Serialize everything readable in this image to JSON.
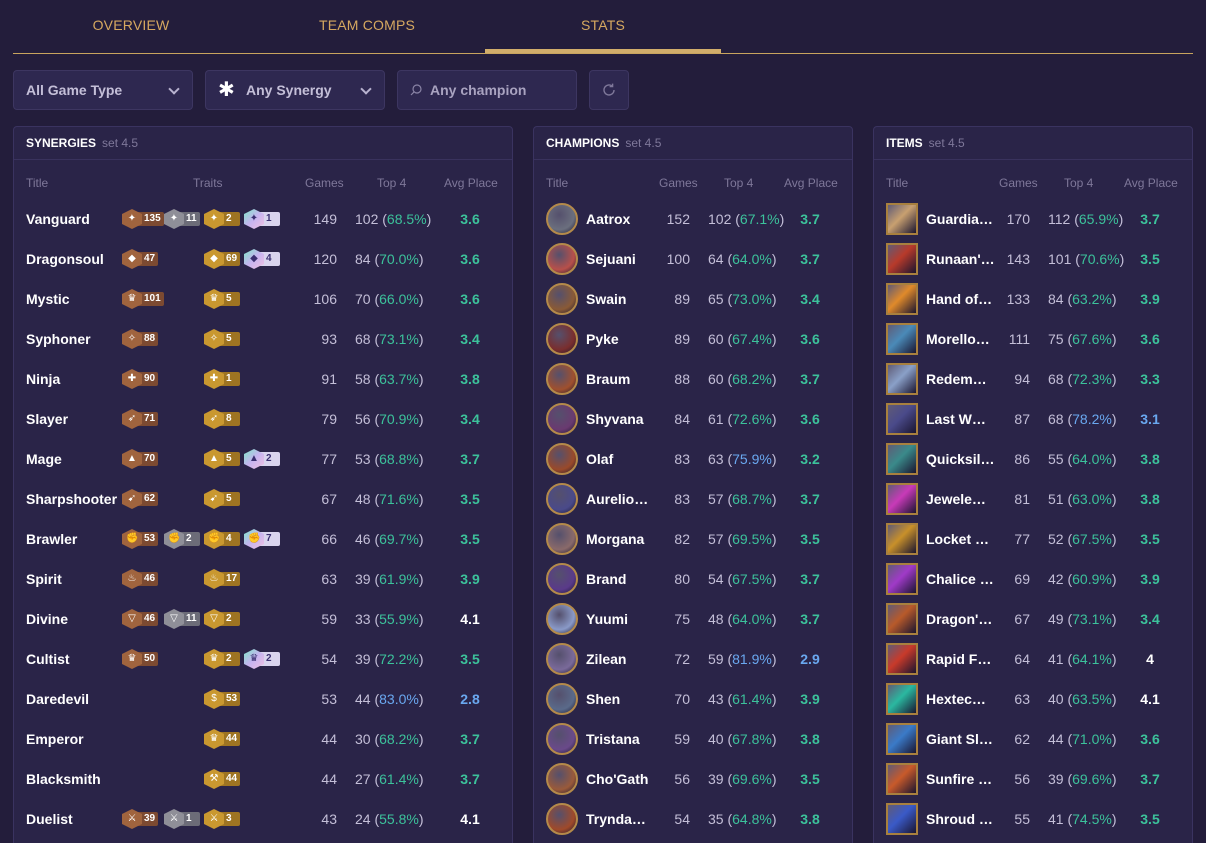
{
  "tabs": [
    {
      "label": "OVERVIEW",
      "active": false
    },
    {
      "label": "TEAM COMPS",
      "active": false
    },
    {
      "label": "STATS",
      "active": true
    }
  ],
  "filters": {
    "game_type": "All Game Type",
    "synergy": "Any Synergy",
    "champion_placeholder": "Any champion"
  },
  "colors": {
    "accent_gold": "#d1ad6b",
    "pct_green": "#3cc29b",
    "pct_blue": "#6aa8f0",
    "background": "#231d3b"
  },
  "synergies": {
    "title": "SYNERGIES",
    "set": "set 4.5",
    "headers": {
      "title": "Title",
      "traits": "Traits",
      "games": "Games",
      "top4": "Top 4",
      "avg": "Avg Place"
    },
    "rows": [
      {
        "name": "Vanguard",
        "traits": [
          {
            "tier": "bronze",
            "count": "135"
          },
          {
            "tier": "silver",
            "count": "11"
          },
          {
            "tier": "gold",
            "count": "2"
          },
          {
            "tier": "chroma",
            "count": "1"
          }
        ],
        "games": "149",
        "top4": "102",
        "pct": "68.5%",
        "avg": "3.6"
      },
      {
        "name": "Dragonsoul",
        "traits": [
          {
            "tier": "bronze",
            "count": "47"
          },
          {
            "tier": "gold",
            "count": "69"
          },
          {
            "tier": "chroma",
            "count": "4"
          }
        ],
        "games": "120",
        "top4": "84",
        "pct": "70.0%",
        "avg": "3.6"
      },
      {
        "name": "Mystic",
        "traits": [
          {
            "tier": "bronze",
            "count": "101"
          },
          {
            "tier": "gold",
            "count": "5"
          }
        ],
        "games": "106",
        "top4": "70",
        "pct": "66.0%",
        "avg": "3.6"
      },
      {
        "name": "Syphoner",
        "traits": [
          {
            "tier": "bronze",
            "count": "88"
          },
          {
            "tier": "gold",
            "count": "5"
          }
        ],
        "games": "93",
        "top4": "68",
        "pct": "73.1%",
        "avg": "3.4"
      },
      {
        "name": "Ninja",
        "traits": [
          {
            "tier": "bronze",
            "count": "90"
          },
          {
            "tier": "gold",
            "count": "1"
          }
        ],
        "games": "91",
        "top4": "58",
        "pct": "63.7%",
        "avg": "3.8"
      },
      {
        "name": "Slayer",
        "traits": [
          {
            "tier": "bronze",
            "count": "71"
          },
          {
            "tier": "gold",
            "count": "8"
          }
        ],
        "games": "79",
        "top4": "56",
        "pct": "70.9%",
        "avg": "3.4"
      },
      {
        "name": "Mage",
        "traits": [
          {
            "tier": "bronze",
            "count": "70"
          },
          {
            "tier": "gold",
            "count": "5"
          },
          {
            "tier": "chroma",
            "count": "2"
          }
        ],
        "games": "77",
        "top4": "53",
        "pct": "68.8%",
        "avg": "3.7"
      },
      {
        "name": "Sharpshooter",
        "traits": [
          {
            "tier": "bronze",
            "count": "62"
          },
          {
            "tier": "gold",
            "count": "5"
          }
        ],
        "games": "67",
        "top4": "48",
        "pct": "71.6%",
        "avg": "3.5"
      },
      {
        "name": "Brawler",
        "traits": [
          {
            "tier": "bronze",
            "count": "53"
          },
          {
            "tier": "silver",
            "count": "2"
          },
          {
            "tier": "gold",
            "count": "4"
          },
          {
            "tier": "chroma",
            "count": "7"
          }
        ],
        "games": "66",
        "top4": "46",
        "pct": "69.7%",
        "avg": "3.5"
      },
      {
        "name": "Spirit",
        "traits": [
          {
            "tier": "bronze",
            "count": "46"
          },
          {
            "tier": "gold",
            "count": "17"
          }
        ],
        "games": "63",
        "top4": "39",
        "pct": "61.9%",
        "avg": "3.9"
      },
      {
        "name": "Divine",
        "traits": [
          {
            "tier": "bronze",
            "count": "46"
          },
          {
            "tier": "silver",
            "count": "11"
          },
          {
            "tier": "gold",
            "count": "2"
          }
        ],
        "games": "59",
        "top4": "33",
        "pct": "55.9%",
        "avg": "4.1"
      },
      {
        "name": "Cultist",
        "traits": [
          {
            "tier": "bronze",
            "count": "50"
          },
          {
            "tier": "gold",
            "count": "2"
          },
          {
            "tier": "chroma",
            "count": "2"
          }
        ],
        "games": "54",
        "top4": "39",
        "pct": "72.2%",
        "avg": "3.5"
      },
      {
        "name": "Daredevil",
        "traits": [
          {
            "tier": "gold",
            "count": "53"
          }
        ],
        "games": "53",
        "top4": "44",
        "pct": "83.0%",
        "avg": "2.8"
      },
      {
        "name": "Emperor",
        "traits": [
          {
            "tier": "gold",
            "count": "44"
          }
        ],
        "games": "44",
        "top4": "30",
        "pct": "68.2%",
        "avg": "3.7"
      },
      {
        "name": "Blacksmith",
        "traits": [
          {
            "tier": "gold",
            "count": "44"
          }
        ],
        "games": "44",
        "top4": "27",
        "pct": "61.4%",
        "avg": "3.7"
      },
      {
        "name": "Duelist",
        "traits": [
          {
            "tier": "bronze",
            "count": "39"
          },
          {
            "tier": "silver",
            "count": "1"
          },
          {
            "tier": "gold",
            "count": "3"
          }
        ],
        "games": "43",
        "top4": "24",
        "pct": "55.8%",
        "avg": "4.1"
      }
    ]
  },
  "champions": {
    "title": "CHAMPIONS",
    "set": "set 4.5",
    "headers": {
      "title": "Title",
      "games": "Games",
      "top4": "Top 4",
      "avg": "Avg Place"
    },
    "rows": [
      {
        "name": "Aatrox",
        "games": "152",
        "top4": "102",
        "pct": "67.1%",
        "avg": "3.7",
        "color": "#6b6f7e"
      },
      {
        "name": "Sejuani",
        "games": "100",
        "top4": "64",
        "pct": "64.0%",
        "avg": "3.7",
        "color": "#b8504a"
      },
      {
        "name": "Swain",
        "games": "89",
        "top4": "65",
        "pct": "73.0%",
        "avg": "3.4",
        "color": "#8a5a36"
      },
      {
        "name": "Pyke",
        "games": "89",
        "top4": "60",
        "pct": "67.4%",
        "avg": "3.6",
        "color": "#7a2e2e"
      },
      {
        "name": "Braum",
        "games": "88",
        "top4": "60",
        "pct": "68.2%",
        "avg": "3.7",
        "color": "#a0502e"
      },
      {
        "name": "Shyvana",
        "games": "84",
        "top4": "61",
        "pct": "72.6%",
        "avg": "3.6",
        "color": "#6a3a70"
      },
      {
        "name": "Olaf",
        "games": "83",
        "top4": "63",
        "pct": "75.9%",
        "avg": "3.2",
        "color": "#9a4a2a"
      },
      {
        "name": "Aurelio…",
        "games": "83",
        "top4": "57",
        "pct": "68.7%",
        "avg": "3.7",
        "color": "#4a4a8a"
      },
      {
        "name": "Morgana",
        "games": "82",
        "top4": "57",
        "pct": "69.5%",
        "avg": "3.5",
        "color": "#8a6a6a"
      },
      {
        "name": "Brand",
        "games": "80",
        "top4": "54",
        "pct": "67.5%",
        "avg": "3.7",
        "color": "#5a3a8a"
      },
      {
        "name": "Yuumi",
        "games": "75",
        "top4": "48",
        "pct": "64.0%",
        "avg": "3.7",
        "color": "#8a9ac8"
      },
      {
        "name": "Zilean",
        "games": "72",
        "top4": "59",
        "pct": "81.9%",
        "avg": "2.9",
        "color": "#7a6a9a"
      },
      {
        "name": "Shen",
        "games": "70",
        "top4": "43",
        "pct": "61.4%",
        "avg": "3.9",
        "color": "#5a6a8a"
      },
      {
        "name": "Tristana",
        "games": "59",
        "top4": "40",
        "pct": "67.8%",
        "avg": "3.8",
        "color": "#6a4a8a"
      },
      {
        "name": "Cho'Gath",
        "games": "56",
        "top4": "39",
        "pct": "69.6%",
        "avg": "3.5",
        "color": "#9a5a3a"
      },
      {
        "name": "Trynda…",
        "games": "54",
        "top4": "35",
        "pct": "64.8%",
        "avg": "3.8",
        "color": "#a04a2a"
      }
    ]
  },
  "items": {
    "title": "ITEMS",
    "set": "set 4.5",
    "headers": {
      "title": "Title",
      "games": "Games",
      "top4": "Top 4",
      "avg": "Avg Place"
    },
    "rows": [
      {
        "name": "Guardia…",
        "games": "170",
        "top4": "112",
        "pct": "65.9%",
        "avg": "3.7",
        "color": "#c8a070"
      },
      {
        "name": "Runaan'…",
        "games": "143",
        "top4": "101",
        "pct": "70.6%",
        "avg": "3.5",
        "color": "#b83a2a"
      },
      {
        "name": "Hand of…",
        "games": "133",
        "top4": "84",
        "pct": "63.2%",
        "avg": "3.9",
        "color": "#e08a2a"
      },
      {
        "name": "Morello…",
        "games": "111",
        "top4": "75",
        "pct": "67.6%",
        "avg": "3.6",
        "color": "#4a8ab8"
      },
      {
        "name": "Redem…",
        "games": "94",
        "top4": "68",
        "pct": "72.3%",
        "avg": "3.3",
        "color": "#8aa0c8"
      },
      {
        "name": "Last W…",
        "games": "87",
        "top4": "68",
        "pct": "78.2%",
        "avg": "3.1",
        "color": "#4a4a8a"
      },
      {
        "name": "Quicksil…",
        "games": "86",
        "top4": "55",
        "pct": "64.0%",
        "avg": "3.8",
        "color": "#3a8a8a"
      },
      {
        "name": "Jewele…",
        "games": "81",
        "top4": "51",
        "pct": "63.0%",
        "avg": "3.8",
        "color": "#c83ab8"
      },
      {
        "name": "Locket …",
        "games": "77",
        "top4": "52",
        "pct": "67.5%",
        "avg": "3.5",
        "color": "#c8902a"
      },
      {
        "name": "Chalice …",
        "games": "69",
        "top4": "42",
        "pct": "60.9%",
        "avg": "3.9",
        "color": "#a03ac8"
      },
      {
        "name": "Dragon'…",
        "games": "67",
        "top4": "49",
        "pct": "73.1%",
        "avg": "3.4",
        "color": "#b85a2a"
      },
      {
        "name": "Rapid F…",
        "games": "64",
        "top4": "41",
        "pct": "64.1%",
        "avg": "4",
        "color": "#c83a2a"
      },
      {
        "name": "Hextec…",
        "games": "63",
        "top4": "40",
        "pct": "63.5%",
        "avg": "4.1",
        "color": "#2ab8a0"
      },
      {
        "name": "Giant Sl…",
        "games": "62",
        "top4": "44",
        "pct": "71.0%",
        "avg": "3.6",
        "color": "#3a7ac8"
      },
      {
        "name": "Sunfire …",
        "games": "56",
        "top4": "39",
        "pct": "69.6%",
        "avg": "3.7",
        "color": "#c85a2a"
      },
      {
        "name": "Shroud …",
        "games": "55",
        "top4": "41",
        "pct": "74.5%",
        "avg": "3.5",
        "color": "#3a5ac8"
      }
    ]
  }
}
